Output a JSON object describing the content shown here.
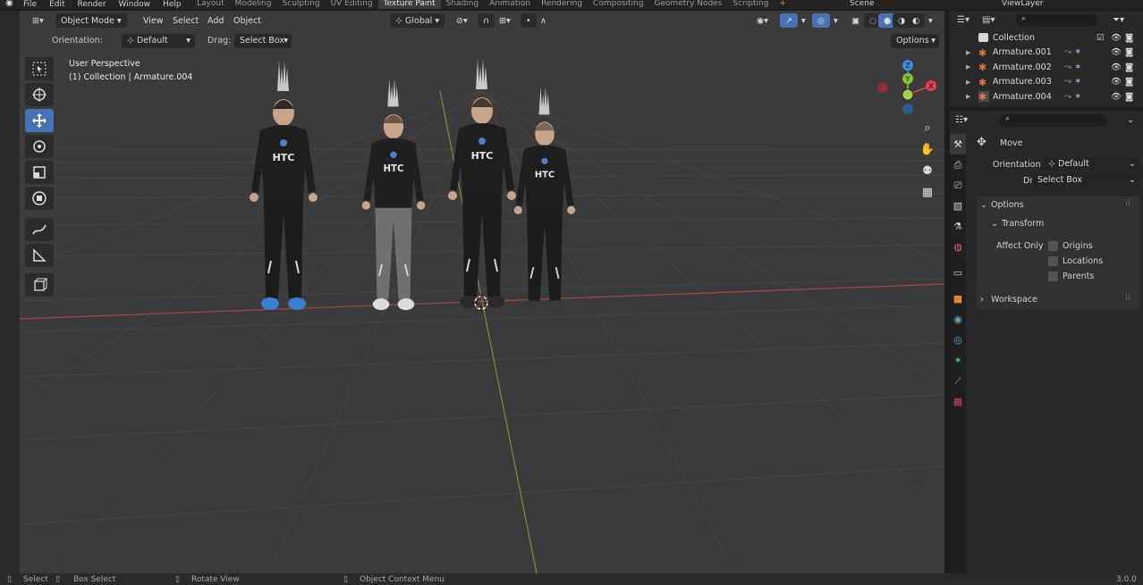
{
  "topbar": {
    "menu": [
      "File",
      "Edit",
      "Render",
      "Window",
      "Help"
    ],
    "workspaces": [
      "Layout",
      "Modeling",
      "Sculpting",
      "UV Editing",
      "Texture Paint",
      "Shading",
      "Animation",
      "Rendering",
      "Compositing",
      "Geometry Nodes",
      "Scripting"
    ],
    "active_workspace": "Texture Paint",
    "scene": "Scene",
    "view_layer": "ViewLayer"
  },
  "viewport_header": {
    "mode": "Object Mode",
    "menus": [
      "View",
      "Select",
      "Add",
      "Object"
    ],
    "transform_orientation": "Global"
  },
  "tool_settings": {
    "orientation_label": "Orientation:",
    "orientation_value": "Default",
    "drag_label": "Drag:",
    "drag_value": "Select Box",
    "options_label": "Options"
  },
  "overlay": {
    "view_name": "User Perspective",
    "context": "(1) Collection | Armature.004"
  },
  "gizmo": {
    "z": "Z",
    "y": "Y",
    "x": "X"
  },
  "characters": [
    {
      "logo": "HTC",
      "shirt": "#1e1e1e",
      "pants": "#1c1c1c",
      "shoes": "#3a7fd0",
      "skin": "#c8a48a",
      "hair": "#2d2a28"
    },
    {
      "logo": "HTC",
      "shirt": "#202020",
      "pants": "#707070",
      "shoes": "#dcdcdc",
      "skin": "#c8a48a",
      "hair": "#6b5843"
    },
    {
      "logo": "HTC",
      "shirt": "#1e1e1e",
      "pants": "#1c1c1c",
      "shoes": "#2a2a2a",
      "skin": "#c8a48a",
      "hair": "#4a3a2c"
    },
    {
      "logo": "HTC",
      "shirt": "#1e1e1e",
      "pants": "#1c1c1c",
      "shoes": "#3a3a3a",
      "skin": "#c8a48a",
      "hair": "#7a6654"
    }
  ],
  "outliner": {
    "root": "Collection",
    "items": [
      "Armature.001",
      "Armature.002",
      "Armature.003",
      "Armature.004"
    ]
  },
  "properties": {
    "tool_name": "Move",
    "orientation_label": "Orientation",
    "orientation_value": "Default",
    "drag_label": "Drag:",
    "drag_value": "Select Box",
    "options_panel": "Options",
    "transform_panel": "Transform",
    "affect_only_label": "Affect Only",
    "affect_only_options": [
      "Origins",
      "Locations",
      "Parents"
    ],
    "workspace_panel": "Workspace"
  },
  "statusbar": {
    "select": "Select",
    "box_select": "Box Select",
    "rotate_view": "Rotate View",
    "context_menu": "Object Context Menu",
    "version": "3.0.0"
  },
  "colors": {
    "accent_blue": "#4772b3",
    "axis_x": "#e0414d",
    "axis_y": "#8bc33a",
    "axis_z": "#3d8ed9",
    "viewport_bg": "#3b3b3b"
  }
}
